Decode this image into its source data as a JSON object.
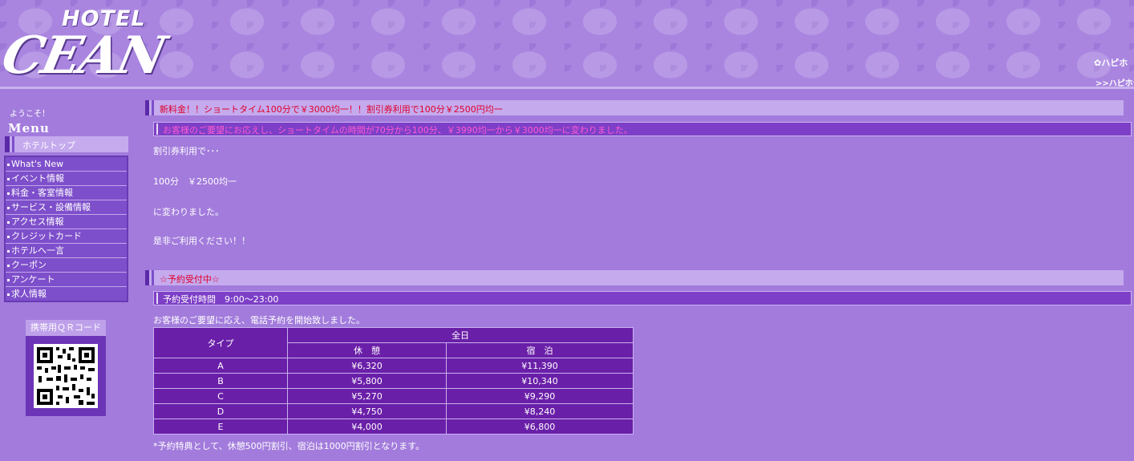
{
  "header": {
    "logo_top": "HOTEL",
    "logo_name": "CEAN",
    "partner_logo": "ハピホ",
    "partner_link": ">>ハピホテ"
  },
  "sidebar": {
    "welcome": "ようこそ！",
    "menu_title": "Menu",
    "hotel_top": "ホテルトップ",
    "items": [
      {
        "label": "What's New"
      },
      {
        "label": "イベント情報"
      },
      {
        "label": "料金・客室情報"
      },
      {
        "label": "サービス・設備情報"
      },
      {
        "label": "アクセス情報"
      },
      {
        "label": "クレジットカード"
      },
      {
        "label": "ホテルへ一言"
      },
      {
        "label": "クーポン"
      },
      {
        "label": "アンケート"
      },
      {
        "label": "求人情報"
      }
    ],
    "qr_title": "携帯用ＱＲコード"
  },
  "news": {
    "title": "新料金！！ショートタイム100分で￥3000均一！！割引券利用で100分￥2500円均一",
    "subtitle": "お客様のご要望にお応えし、ショートタイムの時間が70分から100分、￥3990均一から￥3000均一に変わりました。",
    "lines": [
      "割引券利用で･･･",
      "100分　￥2500均一",
      "に変わりました。",
      "是非ご利用ください！！"
    ]
  },
  "reservation": {
    "title": "☆予約受付中☆",
    "subtitle": "予約受付時間　9:00～23:00",
    "intro": "お客様のご要望に応え、電話予約を開始致しました。",
    "table": {
      "type_header": "タイプ",
      "group_header": "全日",
      "rest_header": "休　憩",
      "stay_header": "宿　泊",
      "rows": [
        {
          "type": "A",
          "rest": "¥6,320",
          "stay": "¥11,390"
        },
        {
          "type": "B",
          "rest": "¥5,800",
          "stay": "¥10,340"
        },
        {
          "type": "C",
          "rest": "¥5,270",
          "stay": "¥9,290"
        },
        {
          "type": "D",
          "rest": "¥4,750",
          "stay": "¥8,240"
        },
        {
          "type": "E",
          "rest": "¥4,000",
          "stay": "¥6,800"
        }
      ]
    },
    "note": "*予約特典として、休憩500円割引、宿泊は1000円割引となります。"
  },
  "colors": {
    "background": "#a27bdc",
    "accent_red": "#e0002a",
    "panel_dark": "#6a1fa8"
  }
}
